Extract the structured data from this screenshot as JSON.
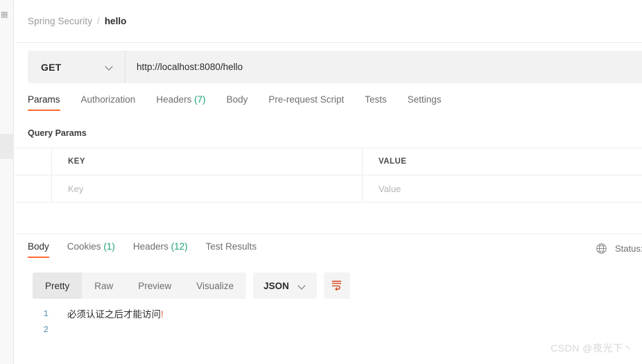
{
  "left_rail": {
    "icon": "apps-grid-icon"
  },
  "breadcrumb": {
    "collection": "Spring Security",
    "separator": "/",
    "current": "hello"
  },
  "request": {
    "method": "GET",
    "url": "http://localhost:8080/hello",
    "tabs": [
      {
        "label": "Params",
        "count": "",
        "active": true
      },
      {
        "label": "Authorization",
        "count": "",
        "active": false
      },
      {
        "label": "Headers",
        "count": "(7)",
        "active": false
      },
      {
        "label": "Body",
        "count": "",
        "active": false
      },
      {
        "label": "Pre-request Script",
        "count": "",
        "active": false
      },
      {
        "label": "Tests",
        "count": "",
        "active": false
      },
      {
        "label": "Settings",
        "count": "",
        "active": false
      }
    ],
    "query_params": {
      "section_label": "Query Params",
      "columns": [
        "KEY",
        "VALUE"
      ],
      "empty_row": {
        "key_placeholder": "Key",
        "value_placeholder": "Value"
      }
    }
  },
  "response": {
    "tabs": [
      {
        "label": "Body",
        "count": "",
        "active": true
      },
      {
        "label": "Cookies",
        "count": "(1)",
        "active": false
      },
      {
        "label": "Headers",
        "count": "(12)",
        "active": false
      },
      {
        "label": "Test Results",
        "count": "",
        "active": false
      }
    ],
    "status": {
      "icon": "globe-icon",
      "label": "Status:"
    },
    "viewer": {
      "modes": [
        {
          "label": "Pretty",
          "active": true
        },
        {
          "label": "Raw",
          "active": false
        },
        {
          "label": "Preview",
          "active": false
        },
        {
          "label": "Visualize",
          "active": false
        }
      ],
      "format": "JSON",
      "wrap_icon": "wrap-text-icon"
    },
    "body_lines": [
      {
        "num": "1",
        "text": "必须认证之后才能访问",
        "suffix": "!"
      },
      {
        "num": "2",
        "text": "",
        "suffix": ""
      }
    ]
  },
  "watermark": "CSDN @夜光下丶",
  "colors": {
    "accent": "#ff6c37",
    "count": "#1aa179",
    "gutter": "#5a8fae"
  }
}
